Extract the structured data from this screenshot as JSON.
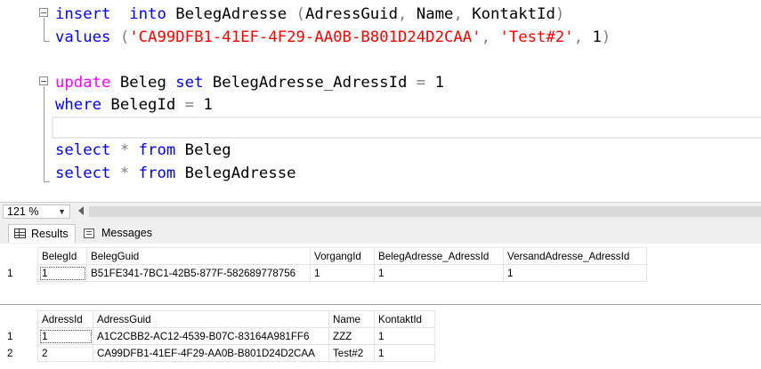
{
  "editor": {
    "lines": [
      {
        "tokens": [
          [
            "kw",
            "insert"
          ],
          [
            "",
            "  "
          ],
          [
            "kw",
            "into"
          ],
          [
            "",
            " BelegAdresse "
          ],
          [
            "op",
            "("
          ],
          [
            "",
            "AdressGuid"
          ],
          [
            "op",
            ","
          ],
          [
            "",
            " Name"
          ],
          [
            "op",
            ","
          ],
          [
            "",
            " KontaktId"
          ],
          [
            "op",
            ")"
          ]
        ]
      },
      {
        "tokens": [
          [
            "kw",
            "values"
          ],
          [
            "",
            " "
          ],
          [
            "op",
            "("
          ],
          [
            "str",
            "'CA99DFB1-41EF-4F29-AA0B-B801D24D2CAA'"
          ],
          [
            "op",
            ","
          ],
          [
            "",
            " "
          ],
          [
            "str",
            "'Test#2'"
          ],
          [
            "op",
            ","
          ],
          [
            "",
            " 1"
          ],
          [
            "op",
            ")"
          ]
        ]
      },
      {
        "tokens": []
      },
      {
        "tokens": [
          [
            "kw2",
            "update"
          ],
          [
            "",
            " Beleg "
          ],
          [
            "kw",
            "set"
          ],
          [
            "",
            " BelegAdresse_AdressId "
          ],
          [
            "op",
            "="
          ],
          [
            "",
            " 1"
          ]
        ]
      },
      {
        "tokens": [
          [
            "kw",
            "where"
          ],
          [
            "",
            " BelegId "
          ],
          [
            "op",
            "="
          ],
          [
            "",
            " 1"
          ]
        ]
      },
      {
        "tokens": []
      },
      {
        "tokens": [
          [
            "kw",
            "select"
          ],
          [
            "",
            " "
          ],
          [
            "op",
            "*"
          ],
          [
            "",
            " "
          ],
          [
            "kw",
            "from"
          ],
          [
            "",
            " Beleg"
          ]
        ]
      },
      {
        "tokens": [
          [
            "kw",
            "select"
          ],
          [
            "",
            " "
          ],
          [
            "op",
            "*"
          ],
          [
            "",
            " "
          ],
          [
            "kw",
            "from"
          ],
          [
            "",
            " BelegAdresse"
          ]
        ]
      }
    ]
  },
  "status_bar": {
    "zoom": "121 %",
    "zoom_caret": "▼"
  },
  "tabs": {
    "results": "Results",
    "messages": "Messages"
  },
  "grid1": {
    "columns": [
      "BelegId",
      "BelegGuid",
      "VorgangId",
      "BelegAdresse_AdressId",
      "VersandAdresse_AdressId"
    ],
    "rows": [
      {
        "num": "1",
        "cells": [
          "1",
          "B51FE341-7BC1-42B5-877F-582689778756",
          "1",
          "1",
          "1"
        ]
      }
    ]
  },
  "grid2": {
    "columns": [
      "AdressId",
      "AdressGuid",
      "Name",
      "KontaktId"
    ],
    "rows": [
      {
        "num": "1",
        "cells": [
          "1",
          "A1C2CBB2-AC12-4539-B07C-83164A981FF6",
          "ZZZ",
          "1"
        ]
      },
      {
        "num": "2",
        "cells": [
          "2",
          "CA99DFB1-41EF-4F29-AA0B-B801D24D2CAA",
          "Test#2",
          "1"
        ]
      }
    ]
  }
}
